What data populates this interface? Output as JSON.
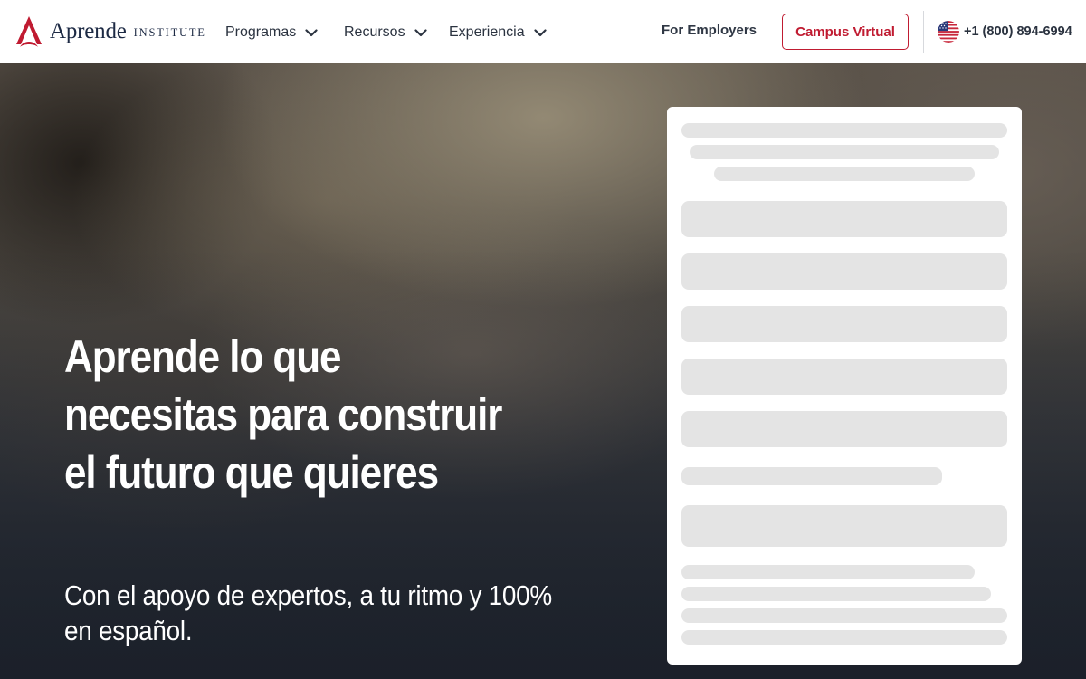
{
  "brand": {
    "name": "Aprende",
    "suffix": "INSTITUTE",
    "accent_color": "#c01b31",
    "navy_color": "#1d2a44"
  },
  "nav": {
    "items": [
      {
        "label": "Programas",
        "icon": "chevron-down-icon"
      },
      {
        "label": "Recursos",
        "icon": "chevron-down-icon"
      },
      {
        "label": "Experiencia",
        "icon": "chevron-down-icon"
      }
    ],
    "employers_label": "For Employers",
    "campus_label": "Campus Virtual",
    "phone": {
      "flag_icon": "us-flag-icon",
      "number": "+1 (800) 894-6994"
    }
  },
  "hero": {
    "title": "Aprende lo que necesitas para construir el futuro que quieres",
    "subtitle": "Con el apoyo de expertos, a tu ritmo y 100% en español."
  },
  "form_card": {
    "state": "loading",
    "skeleton_color": "#e4e4e4"
  }
}
